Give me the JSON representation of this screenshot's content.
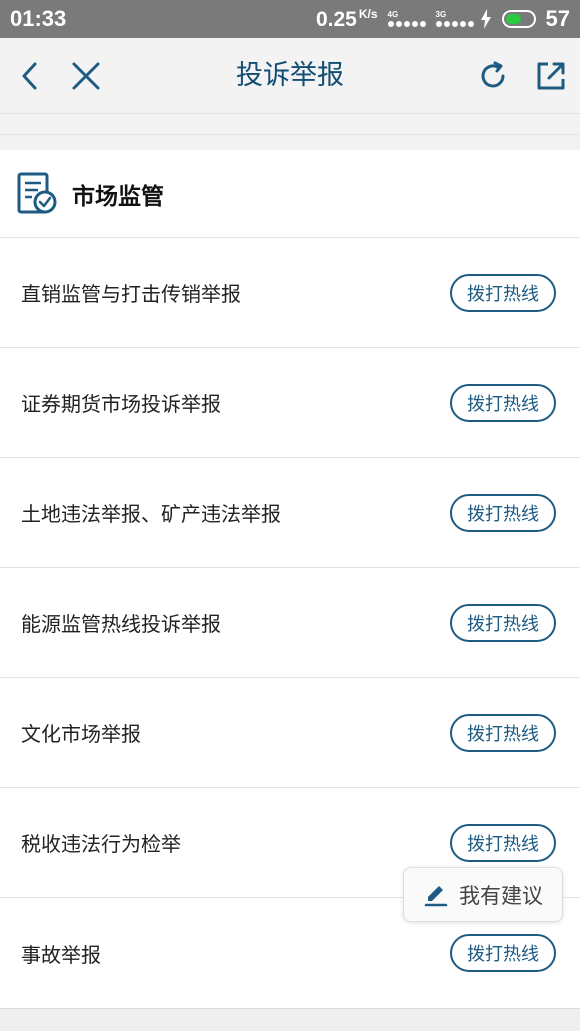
{
  "status_bar": {
    "time": "01:33",
    "net_speed": "0.25",
    "net_unit": "K/s",
    "signal_1": "4G",
    "signal_2": "3G",
    "battery": "57",
    "battery_color": "#29c940"
  },
  "nav": {
    "title": "投诉举报",
    "back_icon": "chevron-left-icon",
    "close_icon": "close-icon",
    "refresh_icon": "refresh-icon",
    "share_icon": "external-link-icon"
  },
  "section": {
    "title": "市场监管",
    "icon": "document-check-icon"
  },
  "items": [
    {
      "label": "直销监管与打击传销举报",
      "button": "拨打热线"
    },
    {
      "label": "证券期货市场投诉举报",
      "button": "拨打热线"
    },
    {
      "label": "土地违法举报、矿产违法举报",
      "button": "拨打热线"
    },
    {
      "label": "能源监管热线投诉举报",
      "button": "拨打热线"
    },
    {
      "label": "文化市场举报",
      "button": "拨打热线"
    },
    {
      "label": "税收违法行为检举",
      "button": "拨打热线"
    },
    {
      "label": "事故举报",
      "button": "拨打热线"
    }
  ],
  "suggest": {
    "label": "我有建议",
    "icon": "pen-icon"
  },
  "colors": {
    "accent": "#1e5b82",
    "title": "#124d73"
  }
}
